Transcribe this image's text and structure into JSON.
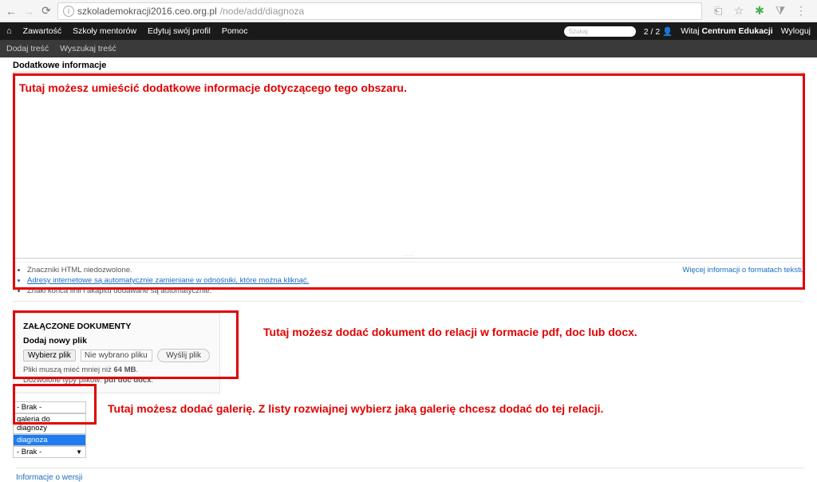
{
  "browser": {
    "url_host": "szkolademokracji2016.ceo.org.pl",
    "url_path": "/node/add/diagnoza"
  },
  "topnav": {
    "items": [
      "Zawartość",
      "Szkoły mentorów",
      "Edytuj swój profil",
      "Pomoc"
    ],
    "search_placeholder": "Szukaj",
    "counter": "2 / 2",
    "greeting_prefix": "Witaj ",
    "greeting_name": "Centrum Edukacji",
    "logout": "Wyloguj"
  },
  "subnav": {
    "items": [
      "Dodaj treść",
      "Wyszukaj treść"
    ]
  },
  "section1": {
    "title": "Dodatkowe informacje",
    "annotation": "Tutaj możesz umieścić dodatkowe informacje dotyczącego tego obszaru.",
    "hints": [
      "Znaczniki HTML niedozwolone.",
      "Adresy internetowe są automatycznie zamieniane w odnośniki, które można kliknąć.",
      "Znaki końca linii i akapitu dodawane są automatycznie."
    ],
    "more_info": "Więcej informacji o formatach tekstu"
  },
  "attachments": {
    "title": "ZAŁĄCZONE DOKUMENTY",
    "subtitle": "Dodaj nowy plik",
    "choose_label": "Wybierz plik",
    "nofile_label": "Nie wybrano pliku",
    "send_label": "Wyślij plik",
    "hint_line1": "Pliki muszą mieć mniej niż ",
    "hint_size": "64 MB",
    "hint_line2": "Dozwolone typy plików: ",
    "hint_types": "pdf doc docx",
    "annotation": "Tutaj możesz dodać dokument do relacji w formacie pdf, doc lub docx."
  },
  "gallery": {
    "options": [
      "- Brak -",
      "galeria do diagnozy",
      "diagnoza"
    ],
    "selected": "- Brak -",
    "annotation": "Tutaj możesz dodać galerię. Z listy rozwiajnej wybierz jaką galerię chcesz dodać do tej relacji."
  },
  "bottom_link": "Informacje o wersji"
}
